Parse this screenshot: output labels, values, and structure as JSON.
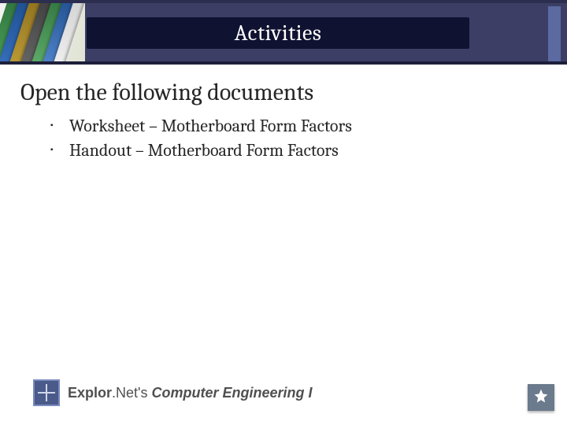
{
  "header": {
    "title": "Activities"
  },
  "content": {
    "heading": "Open the following documents",
    "bullets": [
      "Worksheet – Motherboard Form Factors",
      "Handout – Motherboard Form Factors"
    ]
  },
  "footer": {
    "brand_prefix": "Explor",
    "brand_dot": ".",
    "brand_mid": "Net's ",
    "brand_suffix": "Computer Engineering I"
  }
}
